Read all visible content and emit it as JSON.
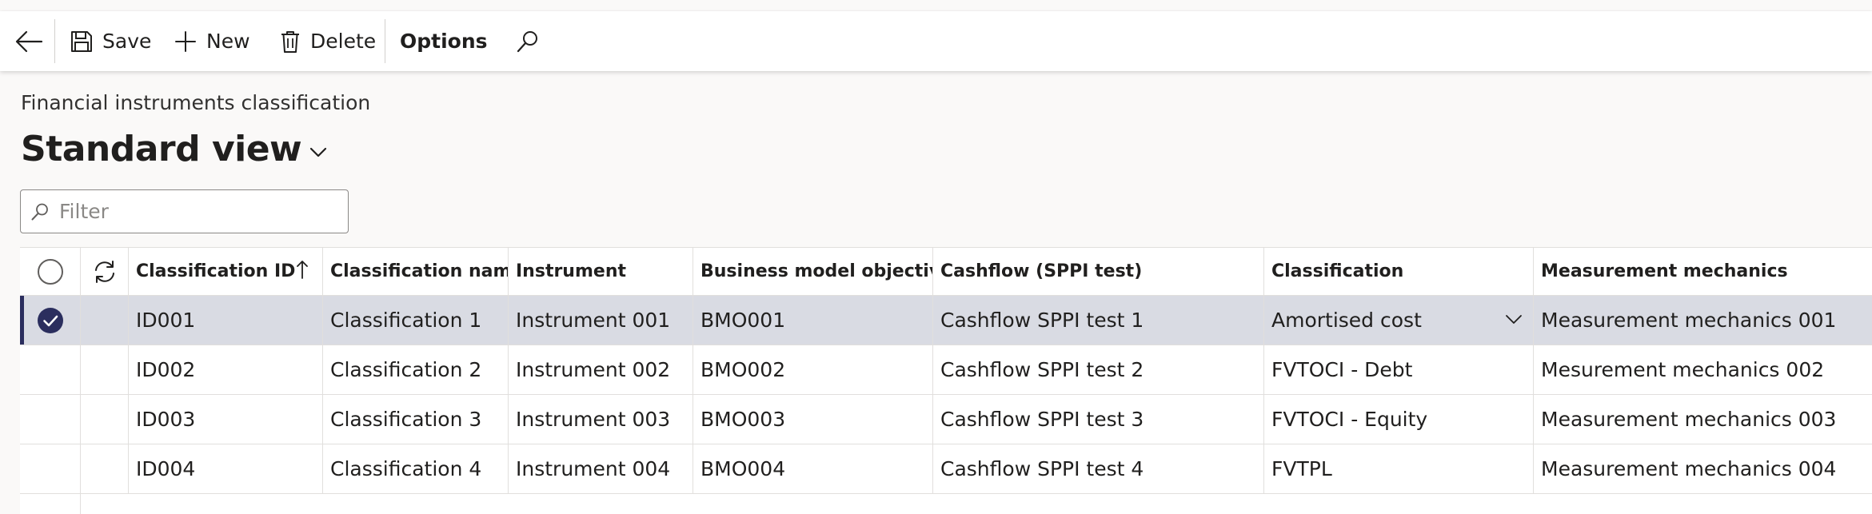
{
  "toolbar": {
    "save_label": "Save",
    "new_label": "New",
    "delete_label": "Delete",
    "options_label": "Options",
    "icons": {
      "back": "back-arrow-icon",
      "save": "save-icon",
      "new": "plus-icon",
      "delete": "trash-icon",
      "search": "search-icon"
    }
  },
  "page": {
    "caption": "Financial instruments classification",
    "view_name": "Standard view"
  },
  "filter": {
    "placeholder": "Filter",
    "value": ""
  },
  "grid": {
    "columns": [
      "Classification ID",
      "Classification name",
      "Instrument",
      "Business model objective",
      "Cashflow (SPPI test)",
      "Classification",
      "Measurement mechanics"
    ],
    "sort": {
      "column": "Classification ID",
      "direction": "ascending"
    },
    "selected_row": 0,
    "rows": [
      [
        "ID001",
        "Classification 1",
        "Instrument 001",
        "BMO001",
        "Cashflow SPPI test 1",
        "Amortised cost",
        "Measurement mechanics 001"
      ],
      [
        "ID002",
        "Classification 2",
        "Instrument 002",
        "BMO002",
        "Cashflow SPPI test 2",
        "FVTOCI - Debt",
        "Mesurement mechanics 002"
      ],
      [
        "ID003",
        "Classification 3",
        "Instrument 003",
        "BMO003",
        "Cashflow SPPI test 3",
        "FVTOCI - Equity",
        "Measurement mechanics 003"
      ],
      [
        "ID004",
        "Classification 4",
        "Instrument 004",
        "BMO004",
        "Cashflow SPPI test 4",
        "FVTPL",
        "Measurement mechanics 004"
      ]
    ]
  },
  "colors": {
    "accent": "#2b2e5e",
    "selected_row": "#d9dbe3",
    "border": "#e1dfdd",
    "background": "#faf9f8"
  }
}
